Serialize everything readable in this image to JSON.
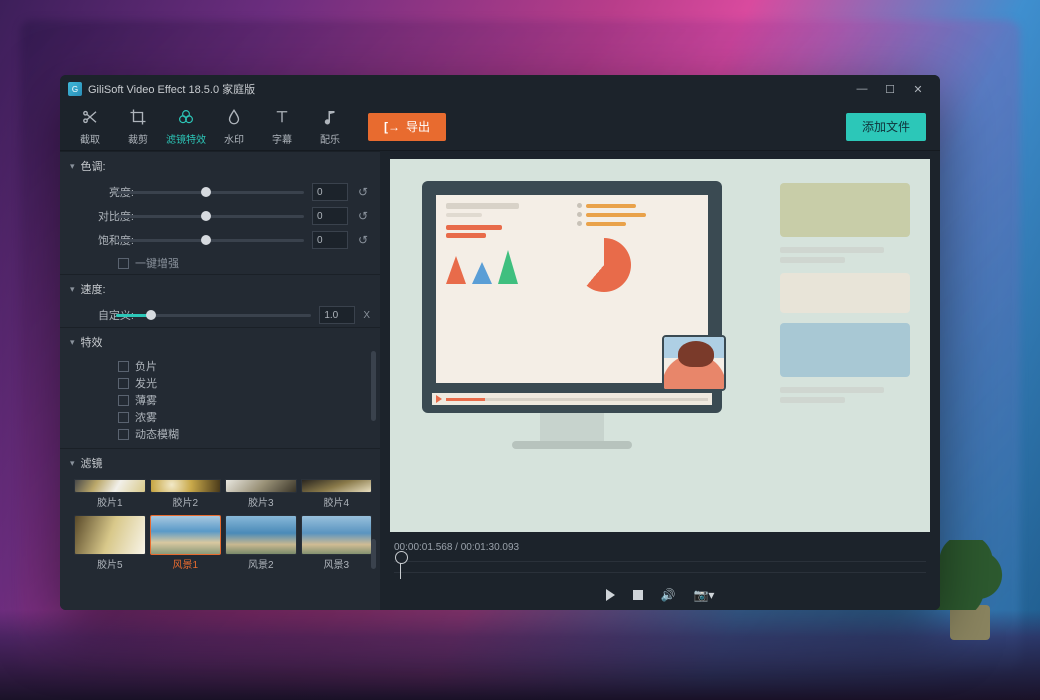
{
  "window": {
    "title": "GiliSoft Video Effect 18.5.0 家庭版"
  },
  "toolbar": {
    "tabs": [
      {
        "label": "截取",
        "icon": "scissors"
      },
      {
        "label": "裁剪",
        "icon": "crop"
      },
      {
        "label": "滤镜特效",
        "icon": "filter",
        "active": true
      },
      {
        "label": "水印",
        "icon": "droplet"
      },
      {
        "label": "字幕",
        "icon": "text"
      },
      {
        "label": "配乐",
        "icon": "music"
      }
    ],
    "export_label": "导出",
    "add_file_label": "添加文件"
  },
  "panel": {
    "sections": {
      "tone": {
        "title": "色调:",
        "sliders": [
          {
            "label": "亮度:",
            "value": "0",
            "pos": 48
          },
          {
            "label": "对比度:",
            "value": "0",
            "pos": 48
          },
          {
            "label": "饱和度:",
            "value": "0",
            "pos": 48
          }
        ],
        "enhance_label": "一键增强"
      },
      "speed": {
        "title": "速度:",
        "custom_label": "自定义:",
        "value": "1.0",
        "suffix": "X",
        "pos": 18
      },
      "effects": {
        "title": "特效",
        "items": [
          "负片",
          "发光",
          "薄雾",
          "浓雾",
          "动态模糊"
        ]
      },
      "filters": {
        "title": "滤镜",
        "items": [
          {
            "name": "胶片1",
            "cls": "th-a"
          },
          {
            "name": "胶片2",
            "cls": "th-b"
          },
          {
            "name": "胶片3",
            "cls": "th-c"
          },
          {
            "name": "胶片4",
            "cls": "th-d"
          },
          {
            "name": "胶片5",
            "cls": "th-e"
          },
          {
            "name": "风景1",
            "cls": "th-f",
            "selected": true
          },
          {
            "name": "风景2",
            "cls": "th-g"
          },
          {
            "name": "风景3",
            "cls": "th-h"
          }
        ]
      }
    }
  },
  "player": {
    "timecode": "00:00:01.568 / 00:01:30.093"
  }
}
